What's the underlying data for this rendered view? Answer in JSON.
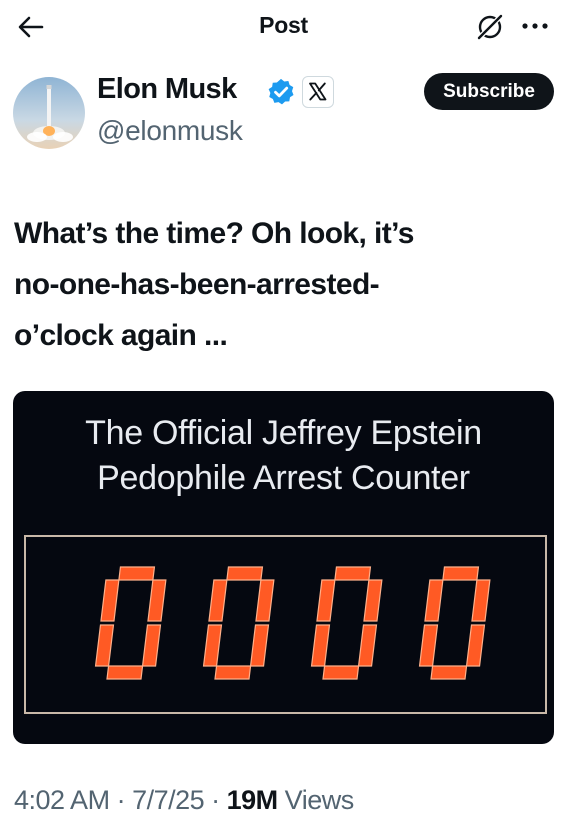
{
  "header": {
    "title": "Post"
  },
  "author": {
    "name": "Elon Musk",
    "handle": "@elonmusk",
    "subscribe_label": "Subscribe",
    "verified_badge_color": "#1d9bf0",
    "affiliate_badge": "x-logo-icon"
  },
  "post": {
    "text_lines": [
      "What’s the time? Oh look, it’s",
      "no-one-has-been-arrested-",
      "o’clock again ..."
    ],
    "media": {
      "caption_lines": [
        "The Official Jeffrey Epstein",
        "Pedophile Arrest Counter"
      ],
      "counter_value": "0000",
      "digit_color": "#ff5a24"
    }
  },
  "meta": {
    "time": "4:02 AM",
    "sep1": " · ",
    "date": "7/7/25",
    "sep2": " · ",
    "views_count": "19M",
    "views_label": " Views"
  }
}
